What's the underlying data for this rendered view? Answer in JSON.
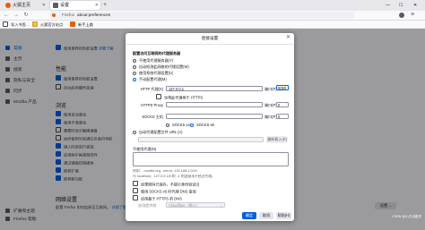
{
  "tabs": [
    {
      "label": "火狐主页",
      "active": false,
      "icon_color": "#e66000"
    },
    {
      "label": "设置",
      "active": true,
      "icon_color": "#5b5b66"
    }
  ],
  "window_controls": {
    "minimize": "—",
    "maximize": "☐",
    "close": "✕"
  },
  "navbar": {
    "back": "←",
    "forward": "→",
    "reload": "↻",
    "url": "about:preferences",
    "url_prefix": "Firefox"
  },
  "bookmarks": {
    "import_label": "导入书签…",
    "folder_label": "火狐官方站点",
    "other_label": "新手上路"
  },
  "sidebar": {
    "items": [
      {
        "label": "常规",
        "active": true
      },
      {
        "label": "主页",
        "active": false
      },
      {
        "label": "搜索",
        "active": false
      },
      {
        "label": "隐私与安全",
        "active": false
      },
      {
        "label": "同步",
        "active": false
      },
      {
        "label": "Mozilla 产品",
        "active": false
      }
    ],
    "footer": [
      {
        "label": "扩展和主题"
      },
      {
        "label": "Firefox 帮助"
      }
    ]
  },
  "main": {
    "perf_header": "性能",
    "browse_header": "浏览",
    "network_header": "网络设置",
    "network_desc": "配置 Firefox 如何连接至互联网。",
    "learn_more": "详细了解",
    "settings_button": "设置…"
  },
  "dialog": {
    "title": "连接设置",
    "close": "✕",
    "section": "配置访问互联网的代理服务器",
    "radios": [
      {
        "label": "不使用代理服务器(Y)",
        "selected": false
      },
      {
        "label": "自动检测此网络的代理设置(W)",
        "selected": false
      },
      {
        "label": "使用系统代理设置(U)",
        "selected": false
      },
      {
        "label": "手动配置代理(M)",
        "selected": true
      }
    ],
    "http_proxy_label": "HTTP 代理(X)",
    "http_proxy_value": "127.0.0.1",
    "port_label": "端口(P)",
    "http_port_value": "8080",
    "also_https": "也将此代理用于 HTTPS",
    "https_proxy_label": "HTTPS Proxy",
    "socks_label": "SOCKS 主机",
    "socks_v4": "SOCKS v4",
    "socks_v5": "SOCKS v5",
    "auto_config_label": "自动代理配置文件 URL (A)",
    "reload_button": "重新载入(E)",
    "no_proxy_label": "不使用代理(N)",
    "example": "例如：.mozilla.org, .net.nz, 192.168.1.0/24",
    "localhost_note": "与 localhost、127.0.0.1/8 和 ::1 的连接永不经过代理。",
    "checks": [
      {
        "label": "如果密码已保存，不提示身份验证(I)",
        "checked": false
      },
      {
        "label": "使用 SOCKS v5 时代理 DNS 查询",
        "checked": false
      },
      {
        "label": "启用基于 HTTPS 的 DNS",
        "checked": false
      }
    ],
    "provider_label": "选用提供商",
    "provider_value": "Cloudflare（默认）",
    "ok": "确定",
    "cancel": "取消",
    "help": "帮助(H)"
  },
  "status_text": "CSDN @小白也能学"
}
